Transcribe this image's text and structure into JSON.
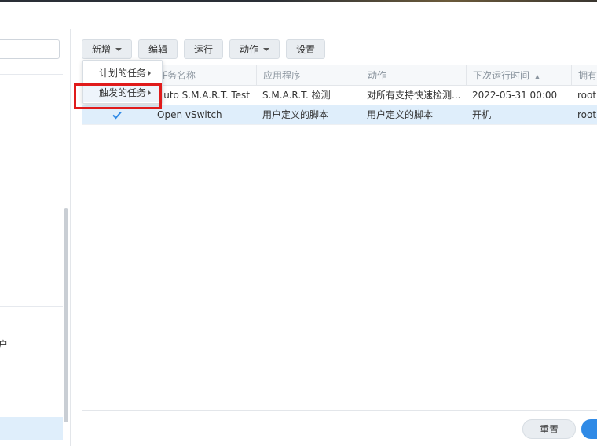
{
  "toolbar": {
    "new_label": "新增",
    "edit_label": "编辑",
    "run_label": "运行",
    "action_label": "动作",
    "settings_label": "设置"
  },
  "new_menu": {
    "items": [
      {
        "label": "计划的任务"
      },
      {
        "label": "触发的任务"
      }
    ]
  },
  "grid": {
    "columns": [
      "任务名称",
      "应用程序",
      "动作",
      "下次运行时间",
      "拥有者"
    ],
    "sort_indicator": "▲",
    "rows": [
      {
        "enabled": false,
        "name": "Auto S.M.A.R.T. Test",
        "app": "S.M.A.R.T. 检测",
        "action": "对所有支持快速检测...",
        "next_run": "2022-05-31 00:00",
        "owner": "root"
      },
      {
        "enabled": true,
        "name": "Open vSwitch",
        "app": "用户定义的脚本",
        "action": "用户定义的脚本",
        "next_run": "开机",
        "owner": "root"
      }
    ]
  },
  "sidebar": {
    "partial_text": "户"
  },
  "footer": {
    "reset_label": "重置"
  },
  "colors": {
    "accent": "#2f8ae6",
    "selection": "#dfeefb",
    "highlight": "#e01b1b"
  }
}
